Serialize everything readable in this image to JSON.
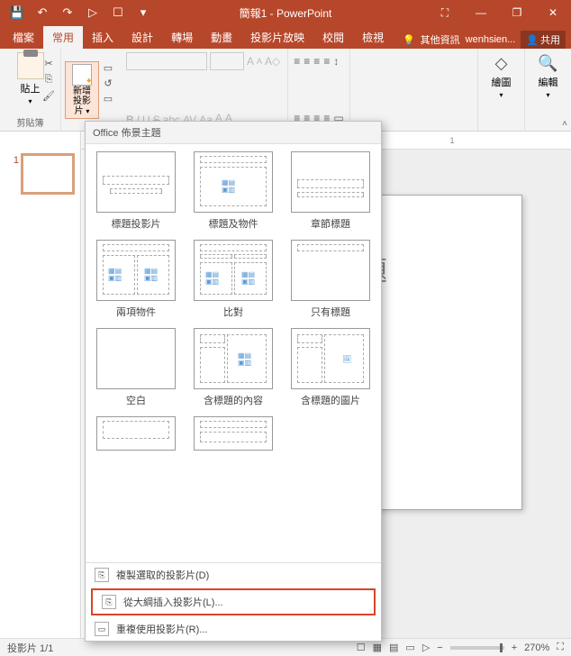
{
  "title_bar": {
    "document_title": "簡報1 - PowerPoint",
    "qat": {
      "save": "💾",
      "undo": "↶",
      "redo": "↷",
      "start": "▷",
      "touch": "☐"
    }
  },
  "window_controls": {
    "ribbon_opts": "⛶",
    "minimize": "—",
    "restore": "❐",
    "close": "✕"
  },
  "tabs": {
    "file": "檔案",
    "home": "常用",
    "insert": "插入",
    "design": "設計",
    "transitions": "轉場",
    "animations": "動畫",
    "slideshow": "投影片放映",
    "review": "校閱",
    "view": "檢視",
    "tell_me": "其他資訊",
    "user": "wenhsien...",
    "share": "共用"
  },
  "ribbon": {
    "clipboard": {
      "paste": "貼上",
      "label": "剪貼簿"
    },
    "slides": {
      "new_slide": "新增",
      "new_slide2": "投影片"
    },
    "font": {
      "bold": "B",
      "italic": "I",
      "underline": "U",
      "strike": "S",
      "shadow": "abc",
      "spacing": "AV",
      "clear": "Aa",
      "color_a": "A",
      "highlight_a": "A"
    },
    "paragraph": {
      "bullets": "≡",
      "numbers": "≡",
      "indent_dec": "≡",
      "indent_inc": "≡",
      "direction": "↕",
      "align_l": "≡",
      "align_c": "≡",
      "align_r": "≡",
      "columns": "≡",
      "convert": "▭"
    },
    "drawing": {
      "label": "繪圖",
      "icon": "◇"
    },
    "editing": {
      "label": "編輯",
      "icon": "🔍"
    }
  },
  "slide_panel": {
    "slide1_num": "1"
  },
  "canvas": {
    "title_placeholder": "增標題"
  },
  "gallery": {
    "header": "Office 佈景主題",
    "layouts": [
      {
        "name": "標題投影片"
      },
      {
        "name": "標題及物件"
      },
      {
        "name": "章節標題"
      },
      {
        "name": "兩項物件"
      },
      {
        "name": "比對"
      },
      {
        "name": "只有標題"
      },
      {
        "name": "空白"
      },
      {
        "name": "含標題的內容"
      },
      {
        "name": "含標題的圖片"
      }
    ],
    "row4": [
      {
        "name": ""
      },
      {
        "name": ""
      }
    ],
    "commands": {
      "duplicate": "複製選取的投影片(D)",
      "from_outline": "從大綱插入投影片(L)...",
      "reuse": "重複使用投影片(R)..."
    }
  },
  "status": {
    "slide_counter": "投影片 1/1",
    "lang": "",
    "notes": "☐",
    "view_normal": "▦",
    "view_sorter": "▤",
    "view_read": "▭",
    "view_show": "▷",
    "zoom": "270%",
    "fit": "⛶"
  },
  "ruler": {
    "mark": "1"
  },
  "chart_data": null
}
